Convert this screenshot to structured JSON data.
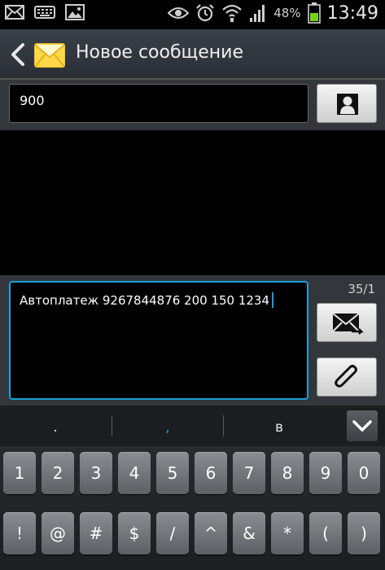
{
  "status_bar": {
    "battery_percent": "48%",
    "time": "13:49",
    "left_icons": [
      "mail-icon",
      "keyboard-icon",
      "image-icon"
    ],
    "right_icons": [
      "eye-icon",
      "alarm-icon",
      "wifi-icon",
      "signal-icon",
      "battery-icon"
    ]
  },
  "action_bar": {
    "title": "Новое сообщение"
  },
  "recipient": {
    "value": "900"
  },
  "compose": {
    "text": "Автоплатеж 9267844876 200 150 1234",
    "counter": "35/1"
  },
  "keyboard": {
    "suggestions": [
      ".",
      ",",
      "в"
    ],
    "number_row": [
      "1",
      "2",
      "3",
      "4",
      "5",
      "6",
      "7",
      "8",
      "9",
      "0"
    ],
    "symbol_row": [
      "!",
      "@",
      "#",
      "$",
      "/",
      "^",
      "&",
      "*",
      "(",
      ")"
    ]
  },
  "colors": {
    "accent": "#1ba1d8",
    "action_bar": "#2f343a",
    "panel": "#33373c"
  }
}
